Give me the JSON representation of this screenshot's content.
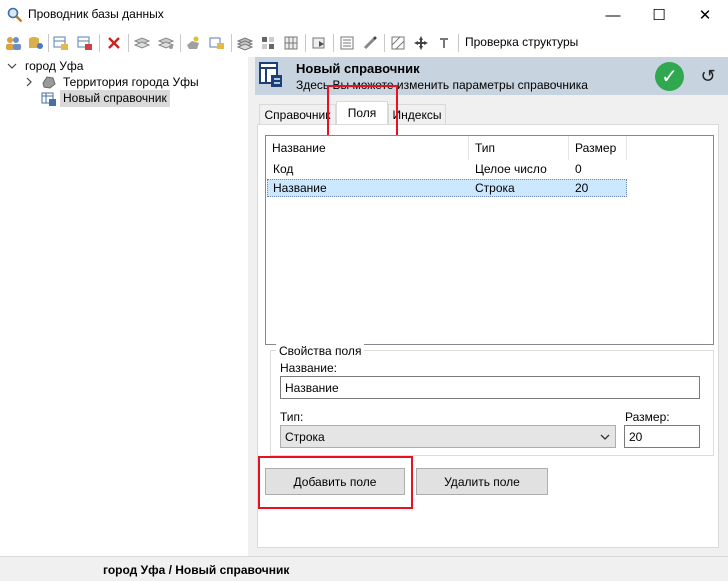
{
  "window": {
    "title": "Проводник базы данных",
    "minimize_glyph": "—",
    "maximize_glyph": "☐",
    "close_glyph": "✕"
  },
  "toolbar": {
    "check_structure": "Проверка структуры"
  },
  "tree": {
    "root": "город Уфа",
    "child1": "Территория города Уфы",
    "child2": "Новый справочник"
  },
  "panel": {
    "title": "Новый справочник",
    "subtitle": "Здесь Вы можете изменить параметры справочника",
    "ok_glyph": "✓",
    "undo_glyph": "↺"
  },
  "tabs": {
    "dictionary": "Справочник",
    "fields": "Поля",
    "indexes": "Индексы"
  },
  "fields_table": {
    "headers": [
      "Название",
      "Тип",
      "Размер"
    ],
    "rows": [
      [
        "Код",
        "Целое число",
        "0"
      ],
      [
        "Название",
        "Строка",
        "20"
      ]
    ]
  },
  "field_props": {
    "group_label": "Свойства поля",
    "name_label": "Название:",
    "name_value": "Название",
    "type_label": "Тип:",
    "type_value": "Строка",
    "size_label": "Размер:",
    "size_value": "20"
  },
  "buttons": {
    "add_field": "Добавить поле",
    "delete_field": "Удалить поле"
  },
  "status": {
    "path": "город Уфа / Новый справочник"
  },
  "colors": {
    "accent_header": "#c7d3df",
    "selection": "#cce8ff",
    "highlight_red": "#e81123",
    "ok_green": "#2fa84f"
  }
}
